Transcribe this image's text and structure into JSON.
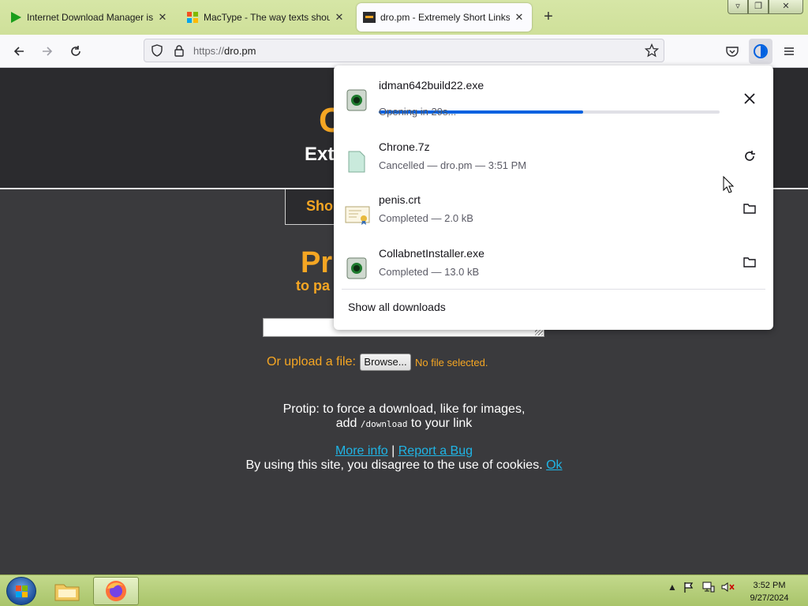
{
  "browser": {
    "tabs": [
      {
        "title": "Internet Download Manager is a po",
        "active": false
      },
      {
        "title": "MacType - The way texts should be",
        "active": false
      },
      {
        "title": "dro.pm - Extremely Short Links",
        "active": true
      }
    ],
    "new_tab_icon": "plus-icon",
    "url_protocol": "https://",
    "url_host": "dro.pm"
  },
  "page": {
    "logo_fragment": "C",
    "hero_subtitle_fragment": "Ext",
    "tab_fragment": "Sho",
    "pro_title_fragment": "Pr",
    "pro_subtitle_fragment": "to pa",
    "upload_label": "Or upload a file:",
    "browse_label": "Browse...",
    "no_file": "No file selected.",
    "protip_line1": "Protip: to force a download, like for images,",
    "protip_line2_pre": "add ",
    "protip_code": "/download",
    "protip_line2_post": " to your link",
    "more_info": "More info",
    "separator": "|",
    "report_bug": "Report a Bug",
    "cookie_text": "By using this site, you disagree to the use of cookies.",
    "cookie_ok": "Ok",
    "accent_color": "#f5a623",
    "link_color": "#1fb5e6"
  },
  "downloads": {
    "items": [
      {
        "name": "idman642build22.exe",
        "status": "Opening in 29s...",
        "progress": 0.6,
        "icon": "exe-icon",
        "action": "cancel-icon"
      },
      {
        "name": "Chrone.7z",
        "status": "Cancelled — dro.pm — 3:51 PM",
        "icon": "file-icon",
        "action": "retry-icon"
      },
      {
        "name": "penis.crt",
        "status": "Completed — 2.0 kB",
        "icon": "certificate-icon",
        "action": "folder-icon"
      },
      {
        "name": "CollabnetInstaller.exe",
        "status": "Completed — 13.0 kB",
        "icon": "exe-icon",
        "action": "folder-icon"
      }
    ],
    "show_all": "Show all downloads"
  },
  "taskbar": {
    "time": "3:52 PM",
    "date": "9/27/2024"
  }
}
